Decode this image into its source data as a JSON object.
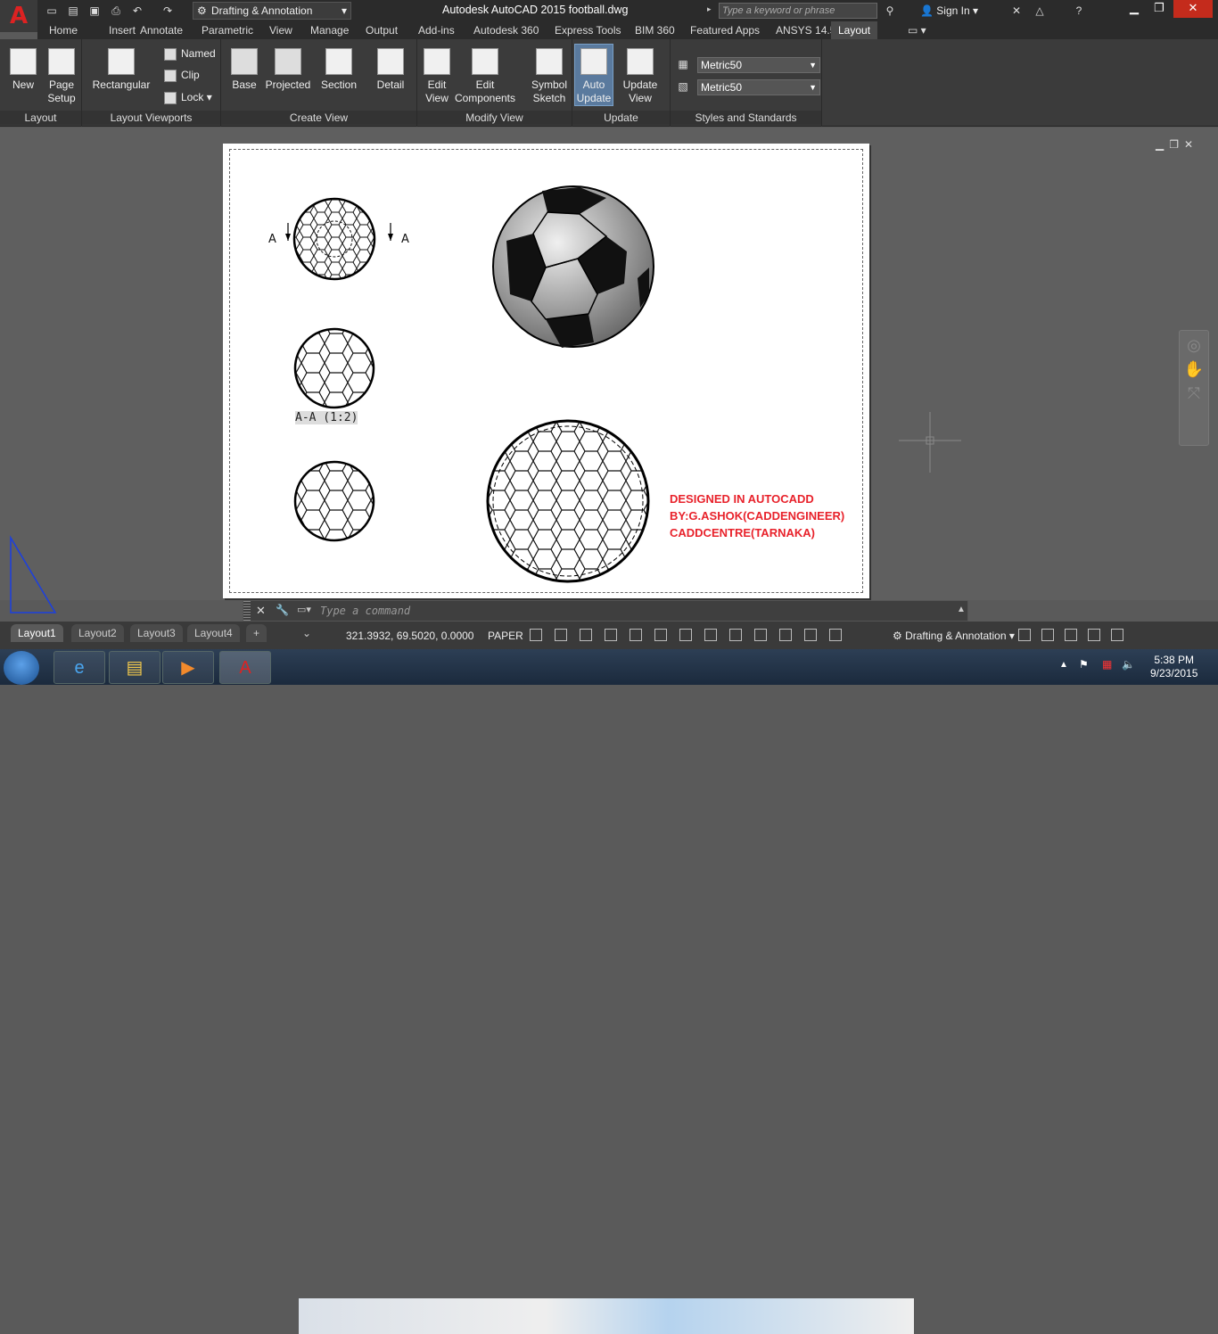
{
  "titlebar": {
    "workspace": "Drafting & Annotation",
    "title": "Autodesk AutoCAD 2015    football.dwg",
    "search_placeholder": "Type a keyword or phrase",
    "signin": "Sign In",
    "app_logo": "A"
  },
  "tabs": [
    "Home",
    "Insert",
    "Annotate",
    "Parametric",
    "View",
    "Manage",
    "Output",
    "Add-ins",
    "Autodesk 360",
    "Express Tools",
    "BIM 360",
    "Featured Apps",
    "ANSYS 14.5",
    "Layout"
  ],
  "active_tab": "Layout",
  "ribbon": {
    "layout_panel": {
      "title": "Layout",
      "new": "New",
      "page_setup_1": "Page",
      "page_setup_2": "Setup"
    },
    "viewports_panel": {
      "title": "Layout Viewports",
      "rectangular": "Rectangular",
      "named": "Named",
      "clip": "Clip",
      "lock": "Lock"
    },
    "create_view_panel": {
      "title": "Create View",
      "base": "Base",
      "projected": "Projected",
      "section": "Section",
      "detail": "Detail"
    },
    "modify_view_panel": {
      "title": "Modify View",
      "edit_view_1": "Edit",
      "edit_view_2": "View",
      "edit_comp_1": "Edit",
      "edit_comp_2": "Components",
      "symbol_1": "Symbol",
      "symbol_2": "Sketch"
    },
    "update_panel": {
      "title": "Update",
      "auto_1": "Auto",
      "auto_2": "Update",
      "upd_1": "Update",
      "upd_2": "View"
    },
    "styles_panel": {
      "title": "Styles and Standards",
      "style1": "Metric50",
      "style2": "Metric50"
    }
  },
  "drawing": {
    "section_label": "A-A (1:2)",
    "section_marker": "A",
    "designer_line1": "DESIGNED IN AUTOCADD",
    "designer_line2": "BY:G.ASHOK(CADDENGINEER)",
    "designer_line3": "CADDCENTRE(TARNAKA)"
  },
  "command": {
    "placeholder": "Type a command"
  },
  "status": {
    "layout_tabs": [
      "Layout1",
      "Layout2",
      "Layout3",
      "Layout4"
    ],
    "active_layout": "Layout1",
    "add_tab": "+",
    "coords": "321.3932, 69.5020, 0.0000",
    "space": "PAPER",
    "workspace": "Drafting & Annotation"
  },
  "taskbar": {
    "time": "5:38 PM",
    "date": "9/23/2015"
  },
  "colors": {
    "accent": "#e8222b",
    "ribbon_bg": "#3b3b3b",
    "canvas": "#5f5f5f"
  }
}
